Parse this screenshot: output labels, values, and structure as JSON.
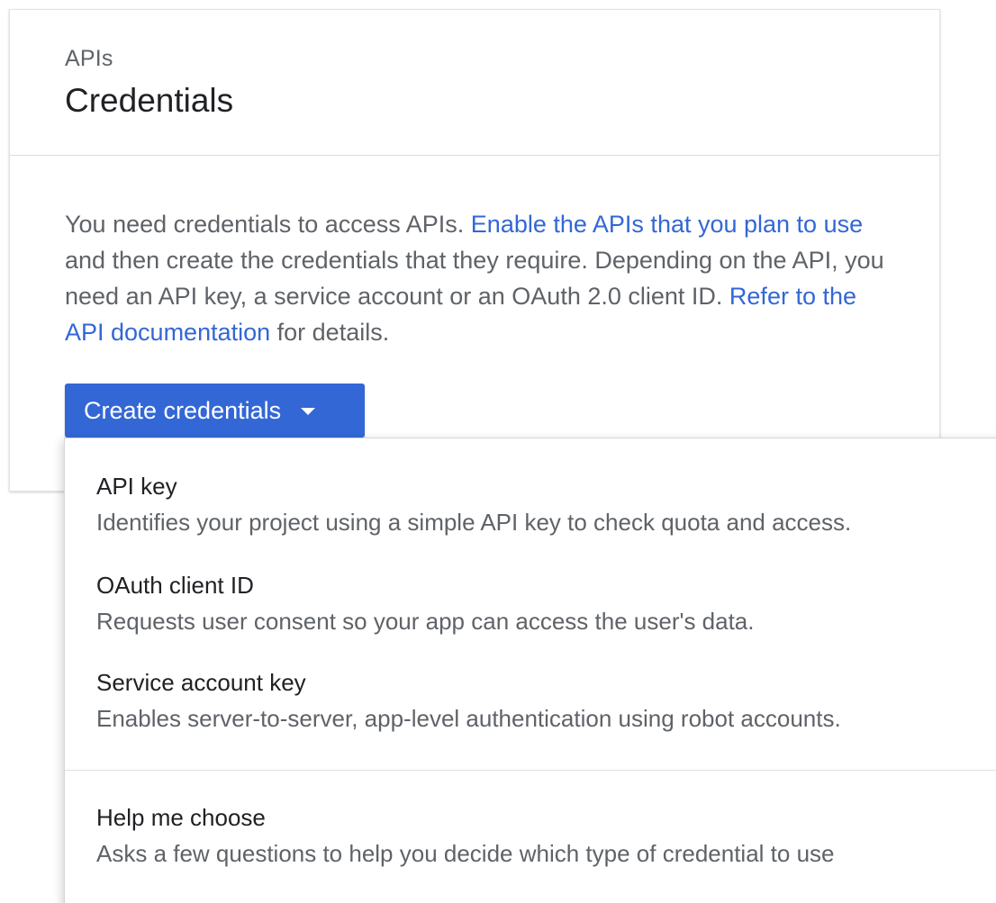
{
  "header": {
    "eyebrow": "APIs",
    "title": "Credentials"
  },
  "intro": {
    "text_1": "You need credentials to access APIs. ",
    "link_enable": "Enable the APIs that you plan to use",
    "text_2": " and then create the credentials that they require. Depending on the API, you need an API key, a service account or an OAuth 2.0 client ID. ",
    "link_docs": "Refer to the API documentation",
    "text_3": " for details."
  },
  "create_button": {
    "label": "Create credentials",
    "icon": "arrow-drop-down-icon"
  },
  "menu": {
    "items": [
      {
        "title": "API key",
        "description": "Identifies your project using a simple API key to check quota and access."
      },
      {
        "title": "OAuth client ID",
        "description": "Requests user consent so your app can access the user's data."
      },
      {
        "title": "Service account key",
        "description": "Enables server-to-server, app-level authentication using robot accounts."
      },
      {
        "title": "Help me choose",
        "description": "Asks a few questions to help you decide which type of credential to use"
      }
    ]
  },
  "colors": {
    "accent": "#3367d6",
    "text_primary": "#202124",
    "text_secondary": "#5f6368"
  }
}
